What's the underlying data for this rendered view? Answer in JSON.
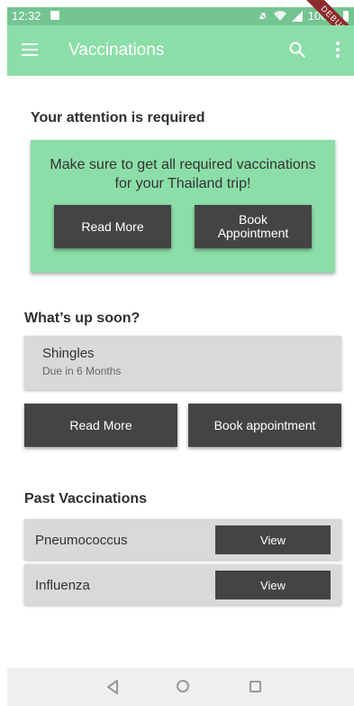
{
  "status_bar": {
    "time": "12:32",
    "battery": "100%",
    "ribbon": "DEBUG"
  },
  "app_bar": {
    "title": "Vaccinations"
  },
  "attention": {
    "heading": "Your attention is required",
    "message_line1": "Make sure to get all required vaccinations",
    "message_line2": "for your Thailand trip!",
    "read_more": "Read More",
    "book_line1": "Book",
    "book_line2": "Appointment"
  },
  "upcoming": {
    "heading": "What’s up soon?",
    "name": "Shingles",
    "due": "Due in 6 Months",
    "read_more": "Read More",
    "book": "Book appointment"
  },
  "past": {
    "heading": "Past Vaccinations",
    "items": [
      {
        "name": "Pneumococcus",
        "action": "View"
      },
      {
        "name": "Influenza",
        "action": "View"
      }
    ]
  },
  "colors": {
    "accent": "#8cdea8",
    "status": "#74c491",
    "button": "#444444"
  }
}
